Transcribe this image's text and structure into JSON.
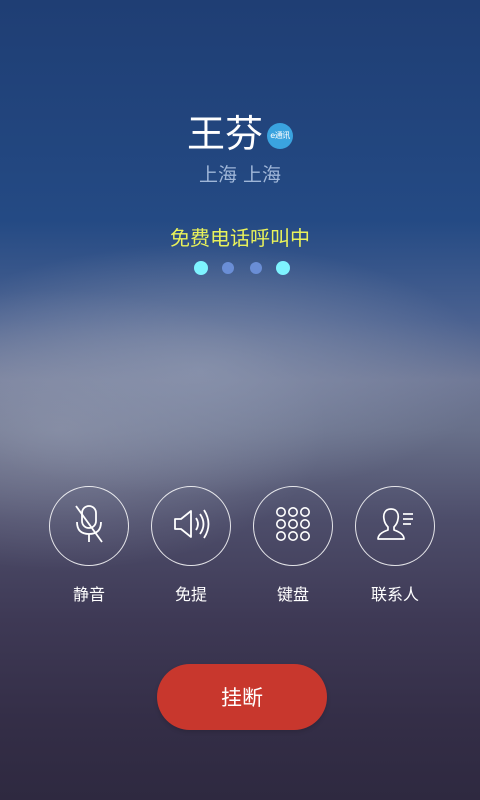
{
  "caller": {
    "name": "王芬",
    "badge": "e通讯",
    "location": "上海 上海"
  },
  "call": {
    "status": "免费电话呼叫中"
  },
  "actions": {
    "mute_label": "静音",
    "speaker_label": "免提",
    "keypad_label": "键盘",
    "contacts_label": "联系人"
  },
  "hangup_label": "挂断",
  "colors": {
    "status_text": "#e9f25a",
    "hangup_button": "#c8372d",
    "badge": "#3aa3df",
    "dot_active": "#7ef3ff",
    "dot_inactive": "#6a8ed6"
  },
  "icons": [
    "mic-muted-icon",
    "speaker-icon",
    "keypad-icon",
    "contacts-icon"
  ]
}
